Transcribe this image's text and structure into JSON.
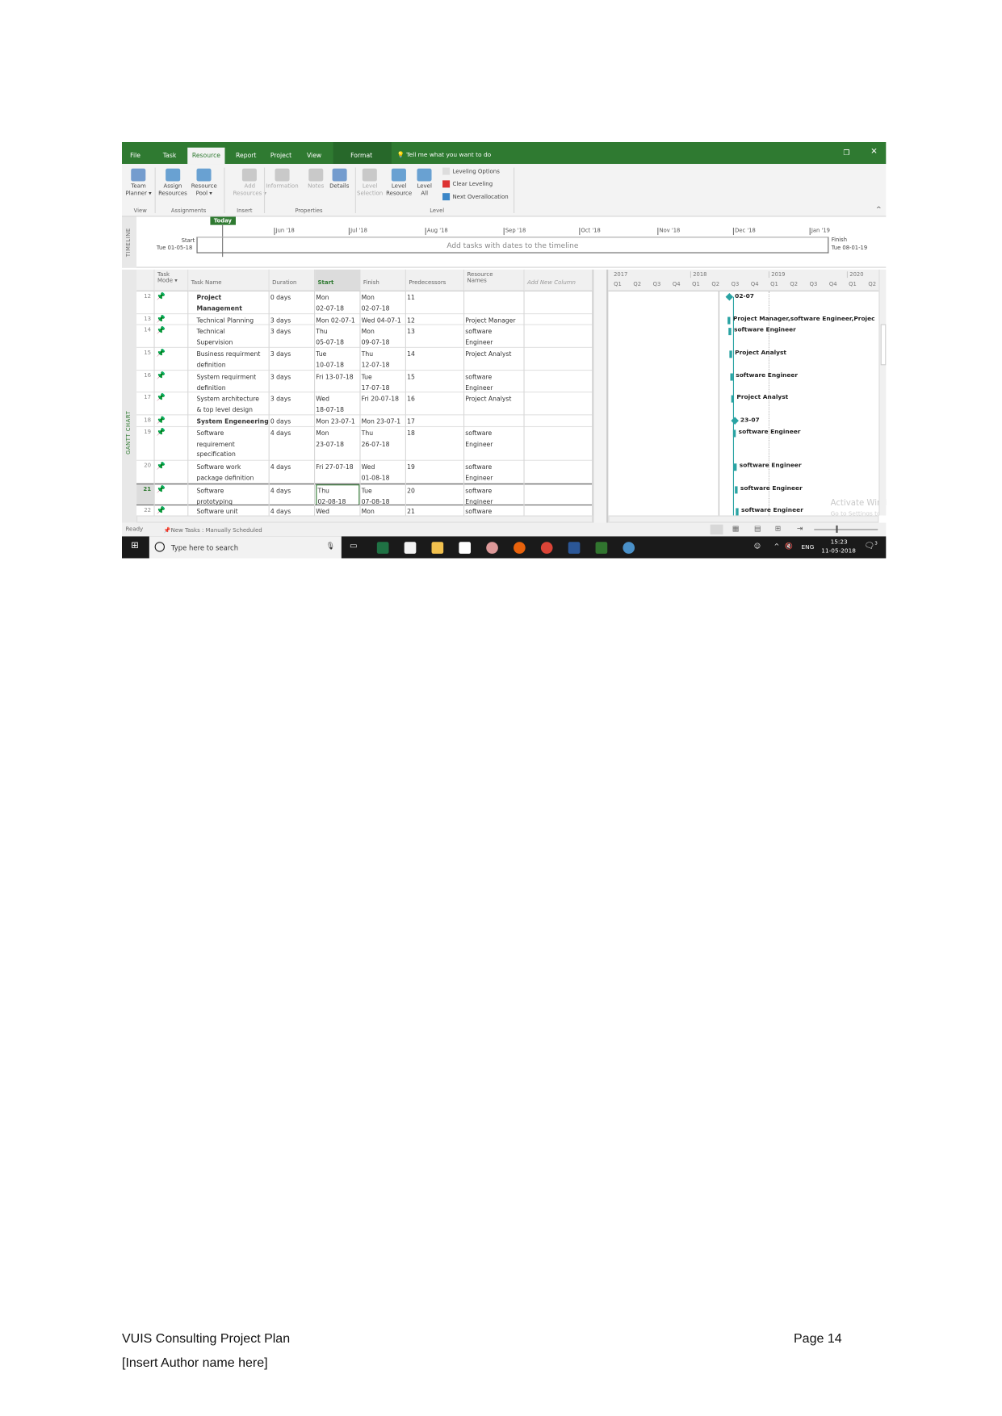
{
  "tabs": [
    "File",
    "Task",
    "Resource",
    "Report",
    "Project",
    "View",
    "Format"
  ],
  "active_tab": "Resource",
  "tell_me": "Tell me what you want to do",
  "ribbon": {
    "buttons": [
      {
        "label": "Team\nPlanner ▾",
        "group": "View",
        "icon": "team-planner-icon"
      },
      {
        "label": "Assign\nResources",
        "icon": "assign-resources-icon"
      },
      {
        "label": "Resource\nPool ▾",
        "icon": "resource-pool-icon"
      },
      {
        "label": "Add\nResources ▾",
        "icon": "add-resources-icon",
        "disabled": true
      },
      {
        "label": "Information",
        "icon": "information-icon",
        "disabled": true
      },
      {
        "label": "Notes",
        "icon": "notes-icon",
        "disabled": true
      },
      {
        "label": "Details",
        "icon": "details-icon"
      },
      {
        "label": "Level\nSelection",
        "icon": "level-selection-icon",
        "disabled": true
      },
      {
        "label": "Level\nResource",
        "icon": "level-resource-icon"
      },
      {
        "label": "Level\nAll",
        "icon": "level-all-icon"
      }
    ],
    "small": [
      "Leveling Options",
      "Clear Leveling",
      "Next Overallocation"
    ],
    "groups": [
      "View",
      "Assignments",
      "Insert",
      "Properties",
      "Level"
    ]
  },
  "timeline": {
    "label": "TIMELINE",
    "today": "Today",
    "start_label": "Start",
    "start_date": "Tue 01-05-18",
    "finish_label": "Finish",
    "finish_date": "Tue 08-01-19",
    "placeholder": "Add tasks with dates to the timeline",
    "months": [
      "Jun '18",
      "Jul '18",
      "Aug '18",
      "Sep '18",
      "Oct '18",
      "Nov '18",
      "Dec '18",
      "Jan '19"
    ]
  },
  "gantt_label": "GANTT CHART",
  "columns": [
    "Task\nMode ▾",
    "Task Name",
    "Duration",
    "Start",
    "Finish",
    "Predecessors",
    "Resource\nNames",
    "Add New Column"
  ],
  "tasks": [
    {
      "id": "12",
      "name": "Project\nManagement",
      "bold": true,
      "duration": "0 days",
      "start": "Mon\n02-07-18",
      "finish": "Mon\n02-07-18",
      "pred": "11",
      "res": "",
      "gantt": "02-07",
      "milestone": true
    },
    {
      "id": "13",
      "name": "Technical Planning",
      "duration": "3 days",
      "start": "Mon 02-07-1",
      "finish": "Wed 04-07-1",
      "pred": "12",
      "res": "Project Manager",
      "gantt": "Project Manager,software Engineer,Projec"
    },
    {
      "id": "14",
      "name": "Technical\nSupervision",
      "duration": "3 days",
      "start": "Thu\n05-07-18",
      "finish": "Mon\n09-07-18",
      "pred": "13",
      "res": "software\nEngineer",
      "gantt": "software Engineer"
    },
    {
      "id": "15",
      "name": "Business requirment\ndefinition",
      "duration": "3 days",
      "start": "Tue\n10-07-18",
      "finish": "Thu\n12-07-18",
      "pred": "14",
      "res": "Project Analyst",
      "gantt": "Project Analyst"
    },
    {
      "id": "16",
      "name": "System requirment\ndefinition",
      "duration": "3 days",
      "start": "Fri 13-07-18",
      "finish": "Tue\n17-07-18",
      "pred": "15",
      "res": "software\nEngineer",
      "gantt": "software Engineer"
    },
    {
      "id": "17",
      "name": "System architecture\n& top level design",
      "duration": "3 days",
      "start": "Wed\n18-07-18",
      "finish": "Fri 20-07-18",
      "pred": "16",
      "res": "Project Analyst",
      "gantt": "Project Analyst"
    },
    {
      "id": "18",
      "name": "System Engeneering",
      "bold": true,
      "duration": "0 days",
      "start": "Mon 23-07-1",
      "finish": "Mon 23-07-1",
      "pred": "17",
      "res": "",
      "gantt": "23-07",
      "milestone": true
    },
    {
      "id": "19",
      "name": "Software\nrequirement\nspecification",
      "duration": "4 days",
      "start": "Mon\n23-07-18",
      "finish": "Thu\n26-07-18",
      "pred": "18",
      "res": "software\nEngineer",
      "gantt": "software Engineer"
    },
    {
      "id": "20",
      "name": "Software work\npackage definition",
      "duration": "4 days",
      "start": "Fri 27-07-18",
      "finish": "Wed\n01-08-18",
      "pred": "19",
      "res": "software\nEngineer",
      "gantt": "software Engineer"
    },
    {
      "id": "21",
      "name": "Software\nprototyping",
      "duration": "4 days",
      "start": "Thu\n02-08-18",
      "finish": "Tue\n07-08-18",
      "pred": "20",
      "res": "software\nEngineer",
      "gantt": "software Engineer",
      "selected": true
    },
    {
      "id": "22",
      "name": "Software unit",
      "duration": "4 days",
      "start": "Wed",
      "finish": "Mon",
      "pred": "21",
      "res": "software",
      "gantt": "software Engineer"
    }
  ],
  "timescale": {
    "years": [
      "2017",
      "2018",
      "2019",
      "2020"
    ],
    "quarters": [
      "Q1",
      "Q2",
      "Q3",
      "Q4",
      "Q1",
      "Q2",
      "Q3",
      "Q4",
      "Q1",
      "Q2",
      "Q3",
      "Q4",
      "Q1",
      "Q2"
    ]
  },
  "watermark": "Activate Windows",
  "watermark2": "Go to Settings to activate Windows.",
  "status": {
    "ready": "Ready",
    "new_tasks": "New Tasks : Manually Scheduled"
  },
  "taskbar": {
    "search": "Type here to search",
    "lang": "ENG",
    "time": "15:23",
    "date": "11-05-2018",
    "notif": "3"
  },
  "colors": {
    "brand": "#2f7a31",
    "gantt_bar": "#2aa3a3"
  },
  "footer": {
    "title": "VUIS Consulting Project Plan",
    "page": "Page 14",
    "author": "[Insert Author name here]"
  }
}
